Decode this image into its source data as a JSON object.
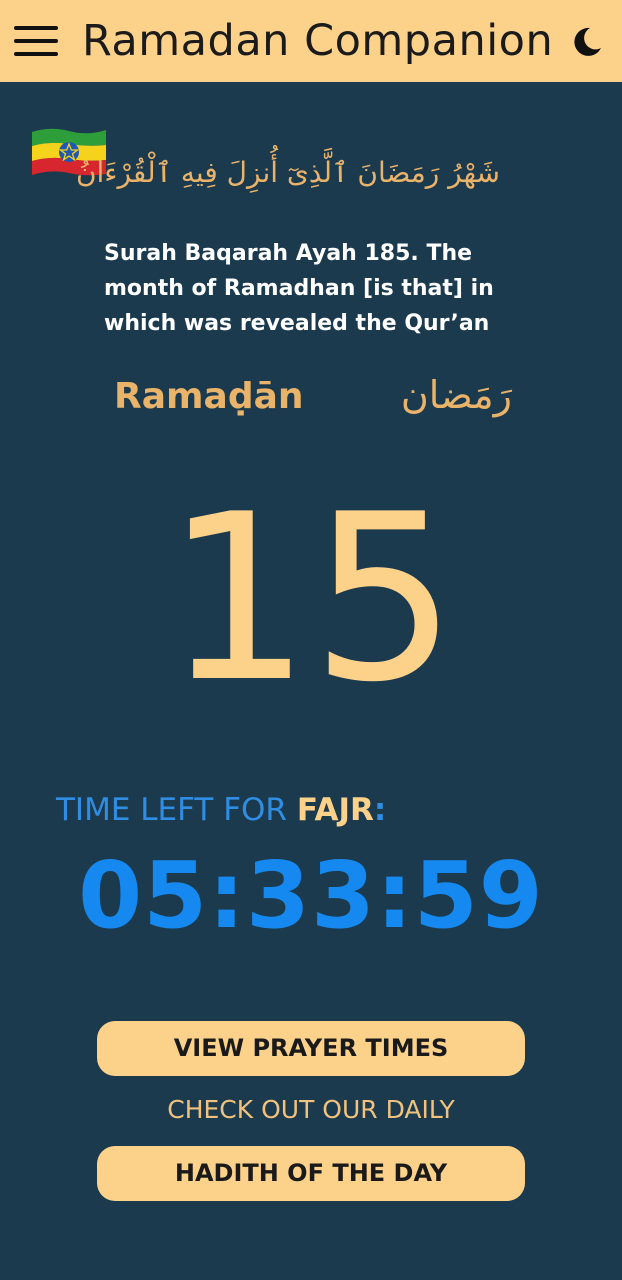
{
  "header": {
    "title": "Ramadan Companion",
    "menu_icon": "hamburger-menu-icon",
    "theme_icon": "moon-icon"
  },
  "hero": {
    "flag_icon": "ethiopia-flag-icon",
    "arabic_verse": "شَهْرُ رَمَضَانَ ٱلَّذِىٓ أُنزِلَ فِيهِ ٱلْقُرْءَانُ",
    "translation": "Surah Baqarah Ayah 185. The month of Ramadhan [is that] in which was revealed the Qur’an"
  },
  "month": {
    "latin": "Ramaḍān",
    "arabic": "رَمَضان"
  },
  "day": {
    "number": "15"
  },
  "countdown": {
    "label_prefix": "TIME LEFT FOR ",
    "prayer_name": "FAJR",
    "label_suffix": ":",
    "time": "05:33:59"
  },
  "actions": {
    "prayer_times_label": "VIEW PRAYER TIMES",
    "daily_caption": "CHECK OUT OUR DAILY",
    "hadith_label": "HADITH OF THE DAY"
  },
  "colors": {
    "background": "#1c3a4e",
    "accent_gold": "#fcd28b",
    "text_gold": "#eab36a",
    "accent_blue": "#1589f0"
  }
}
